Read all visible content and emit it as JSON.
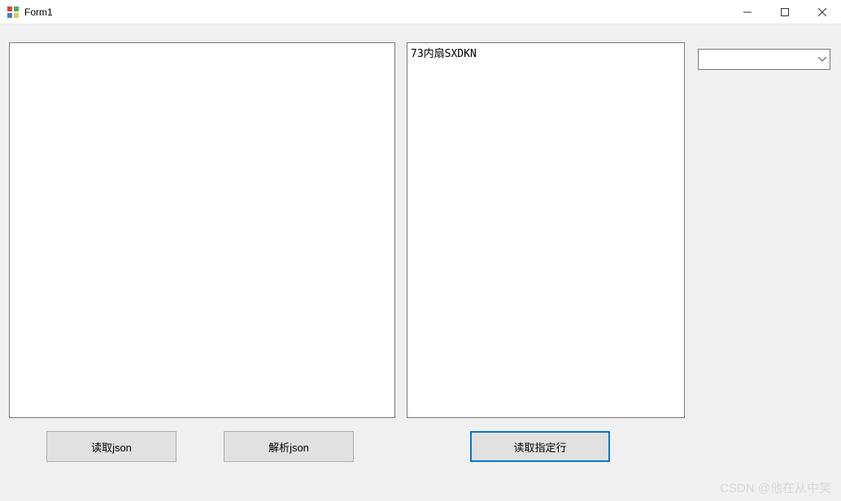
{
  "window": {
    "title": "Form1"
  },
  "textboxes": {
    "left_value": "",
    "right_value": "73内扇SXDKN"
  },
  "combobox": {
    "selected": ""
  },
  "buttons": {
    "read_json": "读取json",
    "parse_json": "解析json",
    "read_line": "读取指定行"
  },
  "watermark": "CSDN @他在从中笑"
}
